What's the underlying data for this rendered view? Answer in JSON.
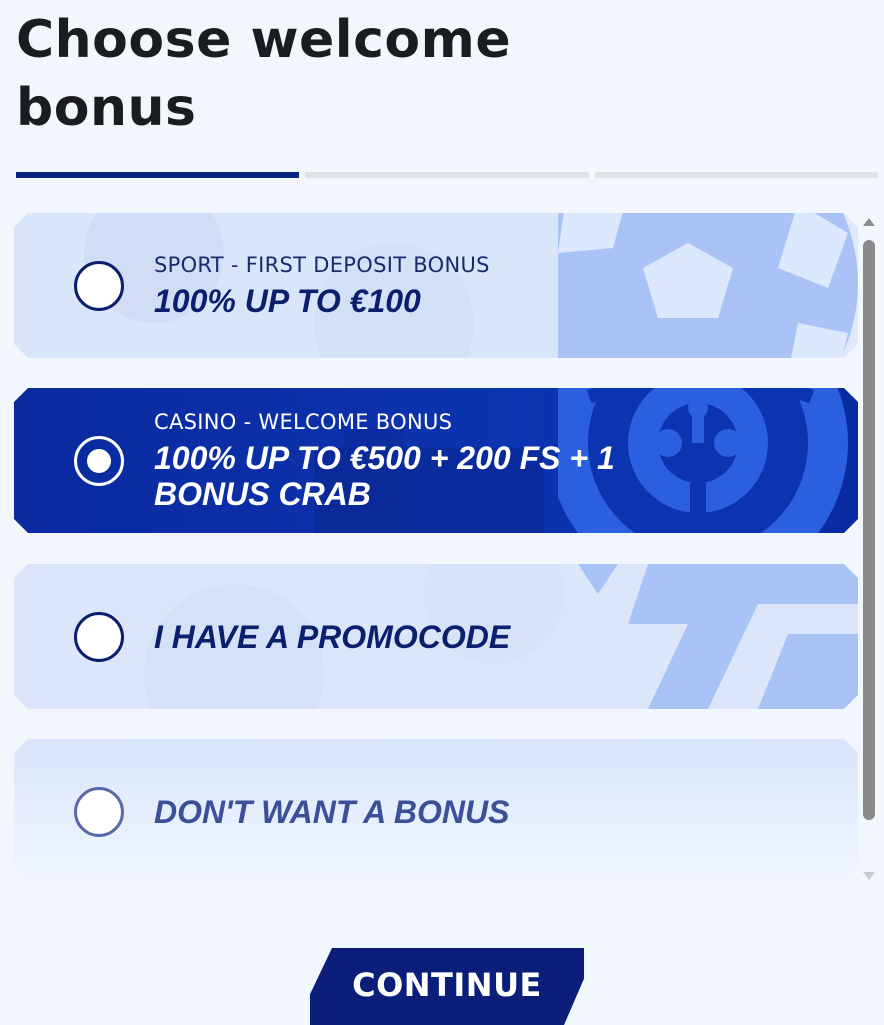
{
  "title": "Choose welcome bonus",
  "progress": {
    "steps": 3,
    "current_step": 1
  },
  "options": [
    {
      "id": "sport",
      "subtitle": "SPORT - FIRST DEPOSIT BONUS",
      "main": "100% UP TO €100",
      "selected": false,
      "deco_icon": "soccer-ball-icon"
    },
    {
      "id": "casino",
      "subtitle": "CASINO - WELCOME BONUS",
      "main": "100% UP TO €500 + 200 FS + 1 BONUS CRAB",
      "selected": true,
      "deco_icon": "roulette-wheel-icon"
    },
    {
      "id": "promocode",
      "subtitle": "",
      "main": "I HAVE A PROMOCODE",
      "selected": false,
      "deco_icon": "lightning-bolt-icon"
    },
    {
      "id": "no-bonus",
      "subtitle": "",
      "main": "DON'T WANT A BONUS",
      "selected": false,
      "deco_icon": ""
    }
  ],
  "continue_label": "CONTINUE",
  "colors": {
    "page_bg": "#f2f7fe",
    "brand_dark": "#0a1d6e",
    "selected_card": "#0a2aa0",
    "card_light": "#dce8fd",
    "progress_active": "#0a2480",
    "progress_inactive": "#dfe3e8"
  }
}
